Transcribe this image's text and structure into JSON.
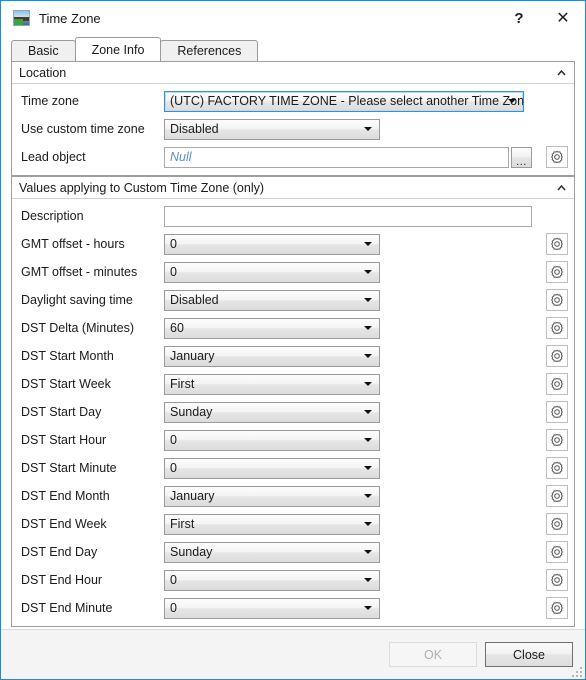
{
  "window": {
    "title": "Time Zone",
    "icon": "timezone-app-icon",
    "help_label": "?",
    "close_label": "✕",
    "border_color": "#1d89d9"
  },
  "tabs": [
    {
      "label": "Basic",
      "selected": false
    },
    {
      "label": "Zone Info",
      "selected": true
    },
    {
      "label": "References",
      "selected": false
    }
  ],
  "groups": [
    {
      "title": "Location",
      "collapse_icon": "chevron-up-icon",
      "rows": [
        {
          "label": "Time zone",
          "control": "combo",
          "value": "(UTC) FACTORY TIME ZONE - Please select another Time Zone!",
          "width": "wide",
          "focused": true,
          "gear": false
        },
        {
          "label": "Use custom time zone",
          "control": "combo",
          "value": "Disabled",
          "width": "small",
          "focused": false,
          "gear": false
        },
        {
          "label": "Lead object",
          "control": "textbox-browse",
          "value": "Null",
          "placeholder_style": true,
          "browse_label": "...",
          "gear": true
        }
      ]
    },
    {
      "title": "Values applying to Custom Time Zone (only)",
      "collapse_icon": "chevron-up-icon",
      "rows": [
        {
          "label": "Description",
          "control": "textbox",
          "value": "",
          "placeholder_style": false,
          "gear": false
        },
        {
          "label": "GMT offset - hours",
          "control": "combo",
          "value": "0",
          "width": "small",
          "gear": true
        },
        {
          "label": "GMT offset - minutes",
          "control": "combo",
          "value": "0",
          "width": "small",
          "gear": true
        },
        {
          "label": "Daylight saving time",
          "control": "combo",
          "value": "Disabled",
          "width": "small",
          "gear": true
        },
        {
          "label": "DST Delta (Minutes)",
          "control": "combo",
          "value": "60",
          "width": "small",
          "gear": true
        },
        {
          "label": "DST Start Month",
          "control": "combo",
          "value": "January",
          "width": "small",
          "gear": true
        },
        {
          "label": "DST Start Week",
          "control": "combo",
          "value": "First",
          "width": "small",
          "gear": true
        },
        {
          "label": "DST Start Day",
          "control": "combo",
          "value": "Sunday",
          "width": "small",
          "gear": true
        },
        {
          "label": "DST Start Hour",
          "control": "combo",
          "value": "0",
          "width": "small",
          "gear": true
        },
        {
          "label": "DST Start Minute",
          "control": "combo",
          "value": "0",
          "width": "small",
          "gear": true
        },
        {
          "label": "DST End Month",
          "control": "combo",
          "value": "January",
          "width": "small",
          "gear": true
        },
        {
          "label": "DST End Week",
          "control": "combo",
          "value": "First",
          "width": "small",
          "gear": true
        },
        {
          "label": "DST End Day",
          "control": "combo",
          "value": "Sunday",
          "width": "small",
          "gear": true
        },
        {
          "label": "DST End Hour",
          "control": "combo",
          "value": "0",
          "width": "small",
          "gear": true
        },
        {
          "label": "DST End Minute",
          "control": "combo",
          "value": "0",
          "width": "small",
          "gear": true
        }
      ]
    }
  ],
  "footer": {
    "ok_label": "OK",
    "ok_enabled": false,
    "close_label": "Close",
    "resize_grip": "resize-grip-icon"
  }
}
